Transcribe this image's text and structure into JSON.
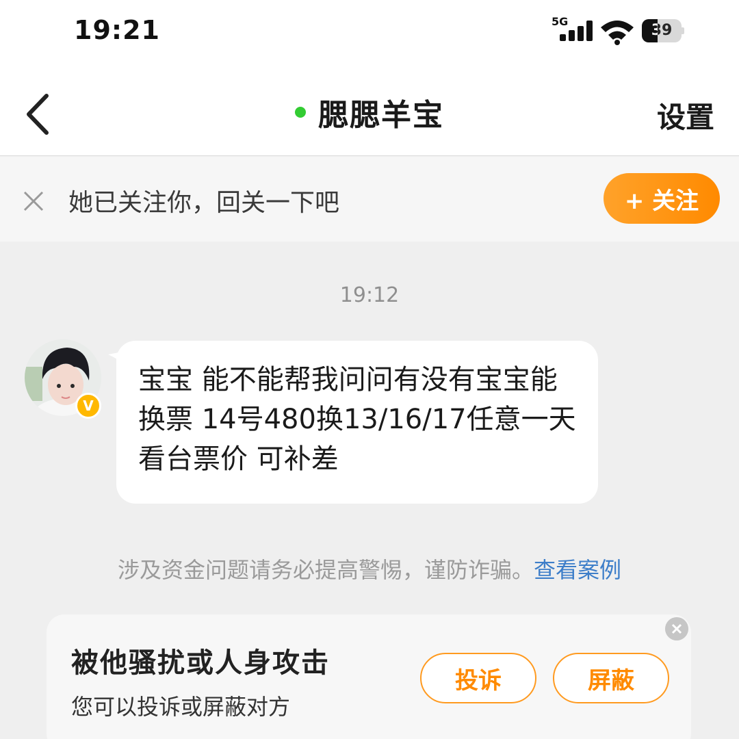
{
  "status_bar": {
    "time": "19:21",
    "network": "5G",
    "battery_level": "39",
    "battery_fraction": 0.39
  },
  "header": {
    "title": "腮腮羊宝",
    "settings_label": "设置",
    "online_color": "#33cc33"
  },
  "follow_banner": {
    "text": "她已关注你，回关一下吧",
    "button_label": "+ 关注",
    "accent": "#ff8a00"
  },
  "chat": {
    "timestamp": "19:12",
    "messages": [
      {
        "from": "other",
        "text": "宝宝 能不能帮我问问有没有宝宝能换票  14号480换13/16/17任意一天看台票价 可补差",
        "verified_badge": "V"
      }
    ]
  },
  "warning": {
    "text": "涉及资金问题请务必提高警惕，谨防诈骗。",
    "link": "查看案例",
    "link_color": "#3d7ec9"
  },
  "report_card": {
    "title": "被他骚扰或人身攻击",
    "subtitle": "您可以投诉或屏蔽对方",
    "complain_label": "投诉",
    "block_label": "屏蔽"
  }
}
